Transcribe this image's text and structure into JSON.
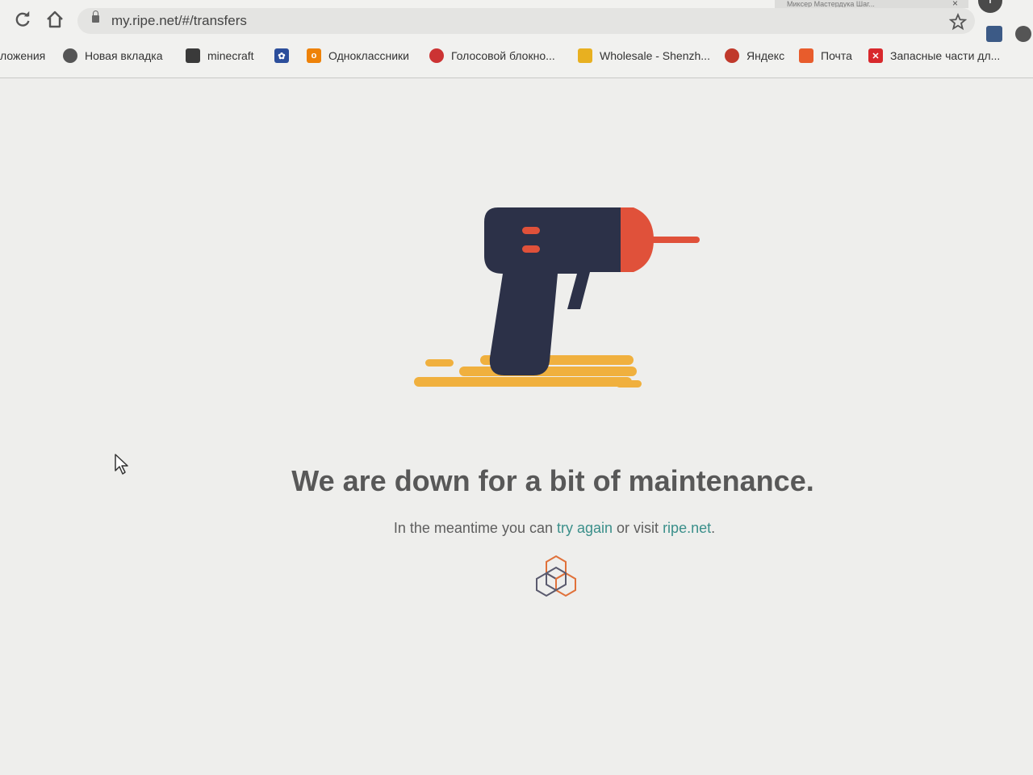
{
  "browser": {
    "tab_title_partial": "Миксер Мастердука Шаг...",
    "tab_close": "×",
    "new_tab": "+",
    "reload_icon": "reload-icon",
    "home_icon": "home-icon",
    "url": "my.ripe.net/#/transfers",
    "bookmark_star_icon": "star-icon",
    "bookmarks": [
      {
        "label": "ложения",
        "icon": "none",
        "color": ""
      },
      {
        "label": "Новая вкладка",
        "icon": "globe-icon",
        "color": "#555555"
      },
      {
        "label": "minecraft",
        "icon": "minecraft-icon",
        "color": "#3a3a3a"
      },
      {
        "label": "",
        "icon": "flower-icon",
        "color": "#2c4e9b"
      },
      {
        "label": "Одноклассники",
        "icon": "odnoklassniki-icon",
        "color": "#ee8208"
      },
      {
        "label": "Голосовой блокно...",
        "icon": "voice-notepad-icon",
        "color": "#cc3333"
      },
      {
        "label": "Wholesale - Shenzh...",
        "icon": "wholesale-icon",
        "color": "#e8b020"
      },
      {
        "label": "Яндекс",
        "icon": "yandex-icon",
        "color": "#c0392b"
      },
      {
        "label": "Почта",
        "icon": "mail-icon",
        "color": "#e85c2c"
      },
      {
        "label": "Запасные части дл...",
        "icon": "spare-parts-icon",
        "color": "#d8282c"
      }
    ]
  },
  "main": {
    "illustration_icon": "drill-icon",
    "headline": "We are down for a bit of maintenance.",
    "sub_prefix": "In the meantime you can ",
    "try_again": "try again",
    "sub_middle": " or visit ",
    "ripe_link": "ripe.net",
    "sub_suffix": ".",
    "logo_icon": "ripe-ncc-logo-icon",
    "colors": {
      "drill_body": "#2c3148",
      "drill_tip": "#e0513a",
      "puddle": "#f0b03e",
      "link": "#3a8f8a",
      "text": "#585858"
    }
  }
}
